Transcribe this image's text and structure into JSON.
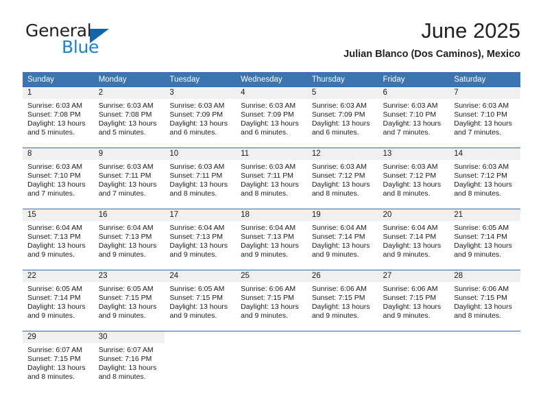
{
  "brand": {
    "name_part1": "General",
    "name_part2": "Blue",
    "logo_icon": "blue-triangle-icon",
    "accent_color": "#1165ab",
    "text_color": "#231f20"
  },
  "header": {
    "month_title": "June 2025",
    "location": "Julian Blanco (Dos Caminos), Mexico"
  },
  "calendar": {
    "header_bg": "#3a74b4",
    "row_divider_color": "#2e6dab",
    "daynum_band_bg": "#f0f0f0",
    "weekday_headers": [
      "Sunday",
      "Monday",
      "Tuesday",
      "Wednesday",
      "Thursday",
      "Friday",
      "Saturday"
    ],
    "weeks": [
      [
        {
          "day": "1",
          "sunrise": "Sunrise: 6:03 AM",
          "sunset": "Sunset: 7:08 PM",
          "daylight_line1": "Daylight: 13 hours",
          "daylight_line2": "and 5 minutes."
        },
        {
          "day": "2",
          "sunrise": "Sunrise: 6:03 AM",
          "sunset": "Sunset: 7:08 PM",
          "daylight_line1": "Daylight: 13 hours",
          "daylight_line2": "and 5 minutes."
        },
        {
          "day": "3",
          "sunrise": "Sunrise: 6:03 AM",
          "sunset": "Sunset: 7:09 PM",
          "daylight_line1": "Daylight: 13 hours",
          "daylight_line2": "and 6 minutes."
        },
        {
          "day": "4",
          "sunrise": "Sunrise: 6:03 AM",
          "sunset": "Sunset: 7:09 PM",
          "daylight_line1": "Daylight: 13 hours",
          "daylight_line2": "and 6 minutes."
        },
        {
          "day": "5",
          "sunrise": "Sunrise: 6:03 AM",
          "sunset": "Sunset: 7:09 PM",
          "daylight_line1": "Daylight: 13 hours",
          "daylight_line2": "and 6 minutes."
        },
        {
          "day": "6",
          "sunrise": "Sunrise: 6:03 AM",
          "sunset": "Sunset: 7:10 PM",
          "daylight_line1": "Daylight: 13 hours",
          "daylight_line2": "and 7 minutes."
        },
        {
          "day": "7",
          "sunrise": "Sunrise: 6:03 AM",
          "sunset": "Sunset: 7:10 PM",
          "daylight_line1": "Daylight: 13 hours",
          "daylight_line2": "and 7 minutes."
        }
      ],
      [
        {
          "day": "8",
          "sunrise": "Sunrise: 6:03 AM",
          "sunset": "Sunset: 7:10 PM",
          "daylight_line1": "Daylight: 13 hours",
          "daylight_line2": "and 7 minutes."
        },
        {
          "day": "9",
          "sunrise": "Sunrise: 6:03 AM",
          "sunset": "Sunset: 7:11 PM",
          "daylight_line1": "Daylight: 13 hours",
          "daylight_line2": "and 7 minutes."
        },
        {
          "day": "10",
          "sunrise": "Sunrise: 6:03 AM",
          "sunset": "Sunset: 7:11 PM",
          "daylight_line1": "Daylight: 13 hours",
          "daylight_line2": "and 8 minutes."
        },
        {
          "day": "11",
          "sunrise": "Sunrise: 6:03 AM",
          "sunset": "Sunset: 7:11 PM",
          "daylight_line1": "Daylight: 13 hours",
          "daylight_line2": "and 8 minutes."
        },
        {
          "day": "12",
          "sunrise": "Sunrise: 6:03 AM",
          "sunset": "Sunset: 7:12 PM",
          "daylight_line1": "Daylight: 13 hours",
          "daylight_line2": "and 8 minutes."
        },
        {
          "day": "13",
          "sunrise": "Sunrise: 6:03 AM",
          "sunset": "Sunset: 7:12 PM",
          "daylight_line1": "Daylight: 13 hours",
          "daylight_line2": "and 8 minutes."
        },
        {
          "day": "14",
          "sunrise": "Sunrise: 6:03 AM",
          "sunset": "Sunset: 7:12 PM",
          "daylight_line1": "Daylight: 13 hours",
          "daylight_line2": "and 8 minutes."
        }
      ],
      [
        {
          "day": "15",
          "sunrise": "Sunrise: 6:04 AM",
          "sunset": "Sunset: 7:13 PM",
          "daylight_line1": "Daylight: 13 hours",
          "daylight_line2": "and 9 minutes."
        },
        {
          "day": "16",
          "sunrise": "Sunrise: 6:04 AM",
          "sunset": "Sunset: 7:13 PM",
          "daylight_line1": "Daylight: 13 hours",
          "daylight_line2": "and 9 minutes."
        },
        {
          "day": "17",
          "sunrise": "Sunrise: 6:04 AM",
          "sunset": "Sunset: 7:13 PM",
          "daylight_line1": "Daylight: 13 hours",
          "daylight_line2": "and 9 minutes."
        },
        {
          "day": "18",
          "sunrise": "Sunrise: 6:04 AM",
          "sunset": "Sunset: 7:13 PM",
          "daylight_line1": "Daylight: 13 hours",
          "daylight_line2": "and 9 minutes."
        },
        {
          "day": "19",
          "sunrise": "Sunrise: 6:04 AM",
          "sunset": "Sunset: 7:14 PM",
          "daylight_line1": "Daylight: 13 hours",
          "daylight_line2": "and 9 minutes."
        },
        {
          "day": "20",
          "sunrise": "Sunrise: 6:04 AM",
          "sunset": "Sunset: 7:14 PM",
          "daylight_line1": "Daylight: 13 hours",
          "daylight_line2": "and 9 minutes."
        },
        {
          "day": "21",
          "sunrise": "Sunrise: 6:05 AM",
          "sunset": "Sunset: 7:14 PM",
          "daylight_line1": "Daylight: 13 hours",
          "daylight_line2": "and 9 minutes."
        }
      ],
      [
        {
          "day": "22",
          "sunrise": "Sunrise: 6:05 AM",
          "sunset": "Sunset: 7:14 PM",
          "daylight_line1": "Daylight: 13 hours",
          "daylight_line2": "and 9 minutes."
        },
        {
          "day": "23",
          "sunrise": "Sunrise: 6:05 AM",
          "sunset": "Sunset: 7:15 PM",
          "daylight_line1": "Daylight: 13 hours",
          "daylight_line2": "and 9 minutes."
        },
        {
          "day": "24",
          "sunrise": "Sunrise: 6:05 AM",
          "sunset": "Sunset: 7:15 PM",
          "daylight_line1": "Daylight: 13 hours",
          "daylight_line2": "and 9 minutes."
        },
        {
          "day": "25",
          "sunrise": "Sunrise: 6:06 AM",
          "sunset": "Sunset: 7:15 PM",
          "daylight_line1": "Daylight: 13 hours",
          "daylight_line2": "and 9 minutes."
        },
        {
          "day": "26",
          "sunrise": "Sunrise: 6:06 AM",
          "sunset": "Sunset: 7:15 PM",
          "daylight_line1": "Daylight: 13 hours",
          "daylight_line2": "and 9 minutes."
        },
        {
          "day": "27",
          "sunrise": "Sunrise: 6:06 AM",
          "sunset": "Sunset: 7:15 PM",
          "daylight_line1": "Daylight: 13 hours",
          "daylight_line2": "and 9 minutes."
        },
        {
          "day": "28",
          "sunrise": "Sunrise: 6:06 AM",
          "sunset": "Sunset: 7:15 PM",
          "daylight_line1": "Daylight: 13 hours",
          "daylight_line2": "and 8 minutes."
        }
      ],
      [
        {
          "day": "29",
          "sunrise": "Sunrise: 6:07 AM",
          "sunset": "Sunset: 7:15 PM",
          "daylight_line1": "Daylight: 13 hours",
          "daylight_line2": "and 8 minutes."
        },
        {
          "day": "30",
          "sunrise": "Sunrise: 6:07 AM",
          "sunset": "Sunset: 7:16 PM",
          "daylight_line1": "Daylight: 13 hours",
          "daylight_line2": "and 8 minutes."
        },
        {
          "day": "",
          "sunrise": "",
          "sunset": "",
          "daylight_line1": "",
          "daylight_line2": ""
        },
        {
          "day": "",
          "sunrise": "",
          "sunset": "",
          "daylight_line1": "",
          "daylight_line2": ""
        },
        {
          "day": "",
          "sunrise": "",
          "sunset": "",
          "daylight_line1": "",
          "daylight_line2": ""
        },
        {
          "day": "",
          "sunrise": "",
          "sunset": "",
          "daylight_line1": "",
          "daylight_line2": ""
        },
        {
          "day": "",
          "sunrise": "",
          "sunset": "",
          "daylight_line1": "",
          "daylight_line2": ""
        }
      ]
    ]
  }
}
